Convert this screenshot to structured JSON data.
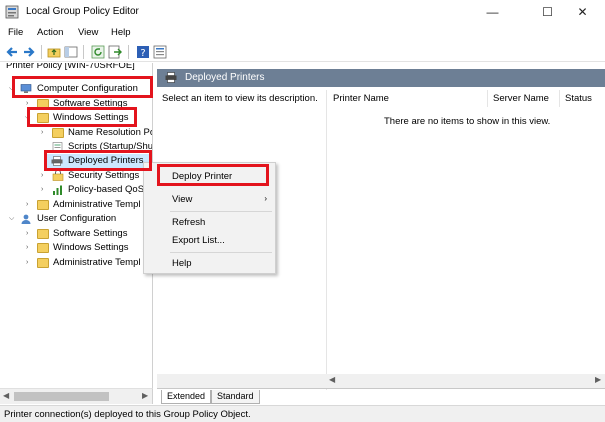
{
  "window": {
    "title": "Local Group Policy Editor",
    "minimize": "—",
    "maximize": "☐",
    "close": "✕"
  },
  "menu": [
    "File",
    "Action",
    "View",
    "Help"
  ],
  "tree": {
    "root": "Printer Policy [WIN-70SRFOE]",
    "computer_config": "Computer Configuration",
    "cc_software": "Software Settings",
    "cc_windows": "Windows Settings",
    "name_resolution": "Name Resolution Po",
    "scripts": "Scripts (Startup/Shu",
    "deployed_printers": "Deployed Printers",
    "security": "Security Settings",
    "qos": "Policy-based QoS",
    "cc_admin": "Administrative Templ",
    "user_config": "User Configuration",
    "uc_software": "Software Settings",
    "uc_windows": "Windows Settings",
    "uc_admin": "Administrative Templ"
  },
  "right_pane": {
    "header": "Deployed Printers",
    "description": "Select an item to view its description.",
    "columns": [
      "Printer Name",
      "Server Name",
      "Status"
    ],
    "empty_message": "There are no items to show in this view."
  },
  "tabs": [
    "Extended",
    "Standard"
  ],
  "status": "Printer connection(s) deployed to this Group Policy Object.",
  "context_menu": {
    "deploy_printer": "Deploy Printer",
    "view": "View",
    "refresh": "Refresh",
    "export_list": "Export List...",
    "help": "Help"
  },
  "colors": {
    "highlight": "#e3141d",
    "header_bar": "#6d7f95",
    "selection": "#cce8ff",
    "folder": "#f4cf5f"
  }
}
